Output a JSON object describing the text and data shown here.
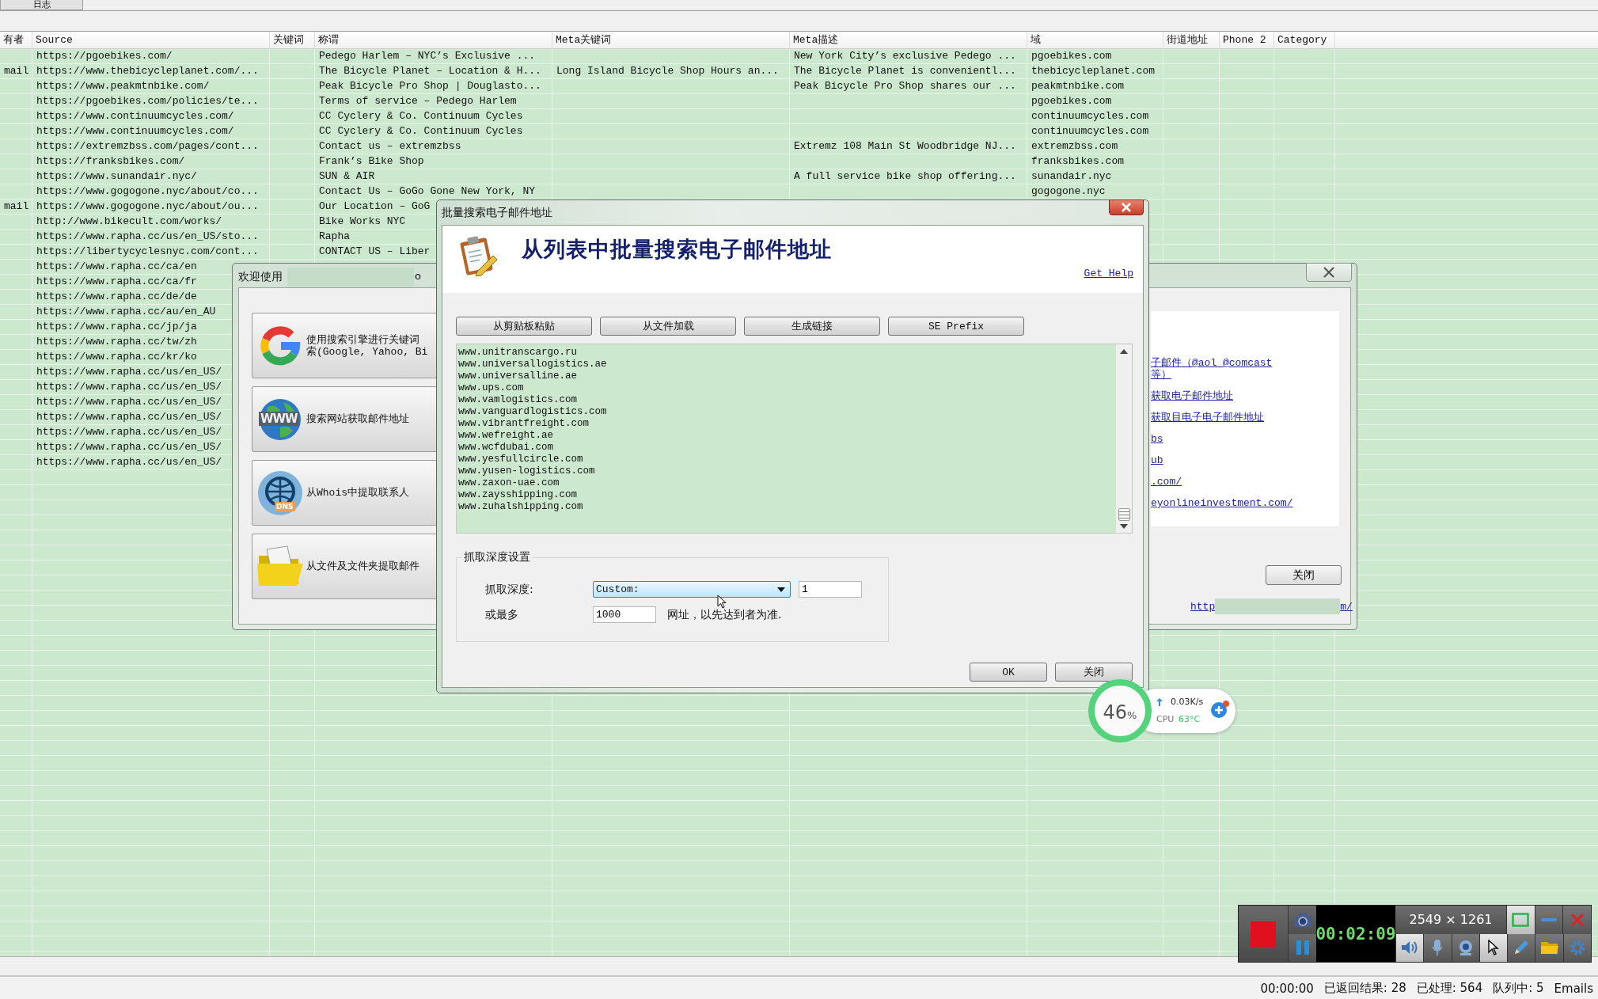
{
  "tab": {
    "label": "日志"
  },
  "table": {
    "columns": [
      "有者",
      "Source",
      "关键词",
      "称谓",
      "Meta关键词",
      "Meta描述",
      "域",
      "街道地址",
      "Phone 2",
      "Category"
    ],
    "rows": [
      {
        "source": "https://pgoebikes.com/",
        "title": "Pedego Harlem – NYC’s Exclusive ...",
        "meta_description": "New York City’s exclusive Pedego ...",
        "domain": "pgoebikes.com"
      },
      {
        "column_1": "mail",
        "source": "https://www.thebicycleplanet.com/...",
        "title": "The Bicycle Planet – Location & H...",
        "meta_keywords": "Long Island Bicycle Shop Hours an...",
        "meta_description": "The Bicycle Planet is convenientl...",
        "domain": "thebicycleplanet.com"
      },
      {
        "source": "https://www.peakmtnbike.com/",
        "title": "Peak Bicycle Pro Shop | Douglasto...",
        "meta_description": "Peak Bicycle Pro Shop shares our ...",
        "domain": "peakmtnbike.com"
      },
      {
        "source": "https://pgoebikes.com/policies/te...",
        "title": "Terms of service – Pedego Harlem",
        "domain": "pgoebikes.com"
      },
      {
        "source": "https://www.continuumcycles.com/",
        "title": "CC Cyclery & Co. Continuum Cycles",
        "domain": "continuumcycles.com"
      },
      {
        "source": "https://www.continuumcycles.com/",
        "title": "CC Cyclery & Co. Continuum Cycles",
        "domain": "continuumcycles.com"
      },
      {
        "source": "https://extremzbss.com/pages/cont...",
        "title": "Contact us – extremzbss",
        "meta_description": "Extremz 108 Main St Woodbridge NJ...",
        "domain": "extremzbss.com"
      },
      {
        "source": "https://franksbikes.com/",
        "title": "Frank’s Bike Shop",
        "domain": "franksbikes.com"
      },
      {
        "source": "https://www.sunandair.nyc/",
        "title": "SUN & AIR",
        "meta_description": "A full service bike shop offering...",
        "domain": "sunandair.nyc"
      },
      {
        "source": "https://www.gogogone.nyc/about/co...",
        "title": "Contact Us – GoGo Gone New York, NY",
        "domain": "gogogone.nyc"
      },
      {
        "column_1": "mail",
        "source": "https://www.gogogone.nyc/about/ou...",
        "title": "Our Location – GoG"
      },
      {
        "source": "http://www.bikecult.com/works/",
        "title": "Bike Works NYC"
      },
      {
        "source": "https://www.rapha.cc/us/en_US/sto...",
        "title": "Rapha"
      },
      {
        "source": "https://libertycyclesnyc.com/cont...",
        "title": "CONTACT US – Liber"
      },
      {
        "source": "https://www.rapha.cc/ca/en"
      },
      {
        "source": "https://www.rapha.cc/ca/fr"
      },
      {
        "source": "https://www.rapha.cc/de/de"
      },
      {
        "source": "https://www.rapha.cc/au/en_AU"
      },
      {
        "source": "https://www.rapha.cc/jp/ja"
      },
      {
        "source": "https://www.rapha.cc/tw/zh"
      },
      {
        "source": "https://www.rapha.cc/kr/ko"
      },
      {
        "source": "https://www.rapha.cc/us/en_US/"
      },
      {
        "source": "https://www.rapha.cc/us/en_US/"
      },
      {
        "source": "https://www.rapha.cc/us/en_US/"
      },
      {
        "source": "https://www.rapha.cc/us/en_US/"
      },
      {
        "source": "https://www.rapha.cc/us/en_US/"
      },
      {
        "source": "https://www.rapha.cc/us/en_US/"
      },
      {
        "source": "https://www.rapha.cc/us/en_US/"
      }
    ]
  },
  "welcome_dialog": {
    "title": "欢迎使用",
    "title_tail": "o",
    "options": [
      {
        "kind": "search_engine",
        "lines": [
          "使用搜索引擎进行关键词",
          "索(Google, Yahoo, Bi"
        ]
      },
      {
        "kind": "website",
        "badge": "WWW",
        "lines": [
          "搜索网站获取邮件地址"
        ]
      },
      {
        "kind": "whois",
        "badge": "DNS",
        "lines": [
          "从Whois中提取联系人"
        ]
      },
      {
        "kind": "files",
        "lines": [
          "从文件及文件夹提取邮件"
        ]
      }
    ],
    "links": [
      "子邮件（@aol @comcast",
      "等）",
      "获取电子邮件地址",
      "获取目电子电子邮件地址",
      "bs",
      "ub",
      ".com/",
      "eyonlineinvestment.com/"
    ],
    "close_button": "关闭",
    "footer_link_start": "http",
    "footer_link_end": "m/"
  },
  "batch_dialog": {
    "title": "批量搜索电子邮件地址",
    "heading": "从列表中批量搜索电子邮件地址",
    "help_link": "Get Help",
    "buttons": [
      "从剪贴板粘贴",
      "从文件加载",
      "生成链接",
      "SE Prefix"
    ],
    "url_list": [
      "www.unitranscargo.ru",
      "www.universallogistics.ae",
      "www.universalline.ae",
      "www.ups.com",
      "www.vamlogistics.com",
      "www.vanguardlogistics.com",
      "www.vibrantfreight.com",
      "www.wefreight.ae",
      "www.wcfdubai.com",
      "www.yesfullcircle.com",
      "www.yusen-logistics.com",
      "www.zaxon-uae.com",
      "www.zaysshipping.com",
      "www.zuhalshipping.com"
    ],
    "depth_group": {
      "title": "抓取深度设置",
      "depth_label": "抓取深度:",
      "depth_select": "Custom:",
      "depth_value": "1",
      "max_label": "或最多",
      "max_value": "1000",
      "max_suffix": "网址，以先达到者为准."
    },
    "actions": [
      "OK",
      "关闭"
    ]
  },
  "network_monitor": {
    "load": "46",
    "load_unit": "%",
    "upload_speed": "0.03K/s",
    "cpu_label": "CPU",
    "cpu_temp": "63°C"
  },
  "screen_recorder": {
    "timer": "00:02:09",
    "resolution": "2549 × 1261"
  },
  "status_bar": [
    "00:00:00",
    "已返回结果: 28",
    "已处理: 564",
    "队列中: 5",
    "Emails"
  ]
}
